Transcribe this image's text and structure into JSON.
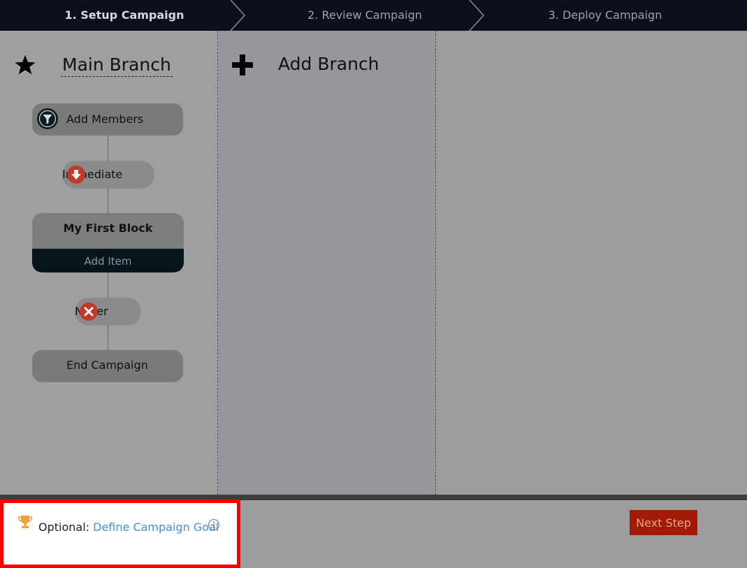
{
  "steps": [
    {
      "label": "1. Setup Campaign"
    },
    {
      "label": "2. Review Campaign"
    },
    {
      "label": "3. Deploy Campaign"
    }
  ],
  "main_branch": {
    "name": "Main Branch",
    "members_label": "Add Members",
    "trigger_label": "Immediate",
    "block": {
      "title": "My First Block",
      "add_item_label": "Add Item"
    },
    "exit_label": "Never",
    "end_label": "End Campaign"
  },
  "add_branch": {
    "label": "Add Branch"
  },
  "goal": {
    "prefix": "Optional:",
    "link_label": "Define Campaign Goal"
  },
  "footer": {
    "next_label": "Next Step"
  },
  "colors": {
    "accent_red": "#a21c05",
    "link_blue": "#3b93e0",
    "trophy_orange": "#f0a03a",
    "topbar": "#0b0e1c"
  }
}
